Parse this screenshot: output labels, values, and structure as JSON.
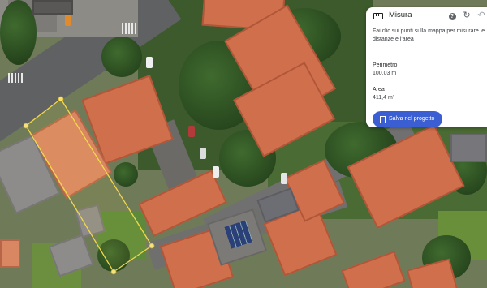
{
  "panel": {
    "title": "Misura",
    "icons": {
      "measure": "ruler-icon",
      "help": "help-icon",
      "reset": "reset-icon",
      "undo": "undo-icon"
    },
    "hint": "Fai clic sui punti sulla mappa per misurare le distanze e l'area",
    "perimeter_label": "Perimetro",
    "perimeter_value": "100,03 m",
    "area_label": "Area",
    "area_value": "411,4 m²",
    "save_label": "Salva nel progetto",
    "save_icon": "bookmark-icon",
    "accent_color": "#3b5fd3"
  },
  "map": {
    "type": "satellite",
    "measure_line_color": "#f2d84a"
  }
}
